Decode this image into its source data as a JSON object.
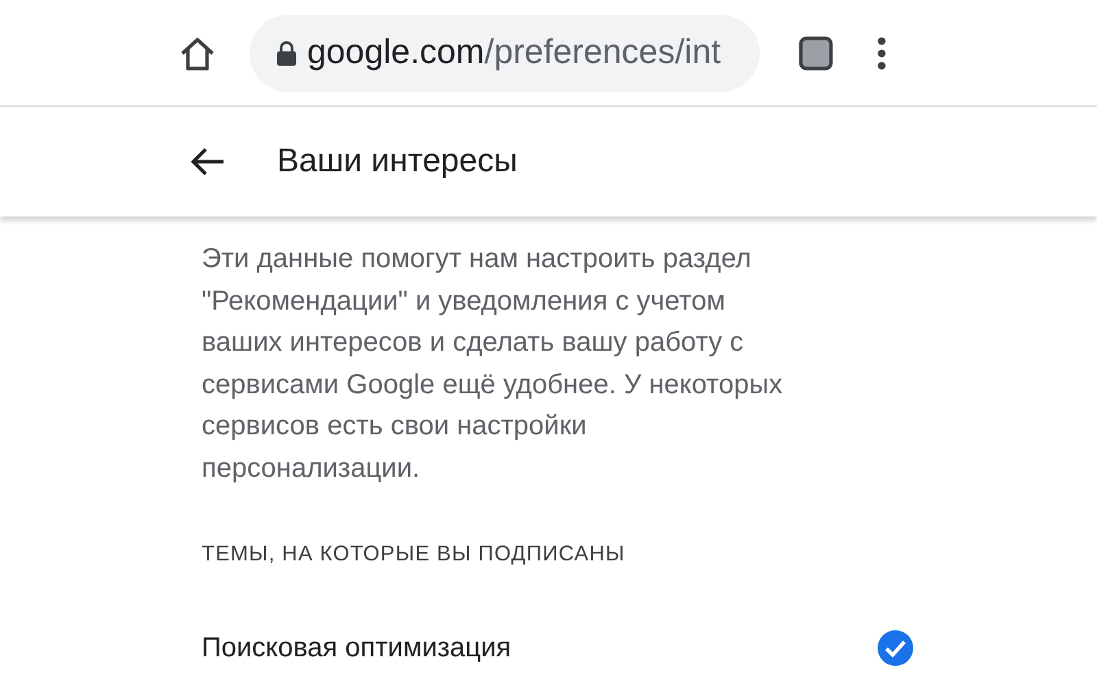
{
  "browser": {
    "url_host": "google.com",
    "url_path": "/preferences/int"
  },
  "header": {
    "title": "Ваши интересы"
  },
  "description": "Эти данные помогут нам настроить раздел\n\"Рекомендации\" и уведомления с учетом\nваших интересов и сделать вашу работу с\nсервисами Google ещё удобнее. У некоторых\nсервисов есть свои настройки\nперсонализации.",
  "section_title": "ТЕМЫ, НА КОТОРЫЕ ВЫ ПОДПИСАНЫ",
  "topics": [
    {
      "label": "Поисковая оптимизация",
      "checked": true
    }
  ]
}
